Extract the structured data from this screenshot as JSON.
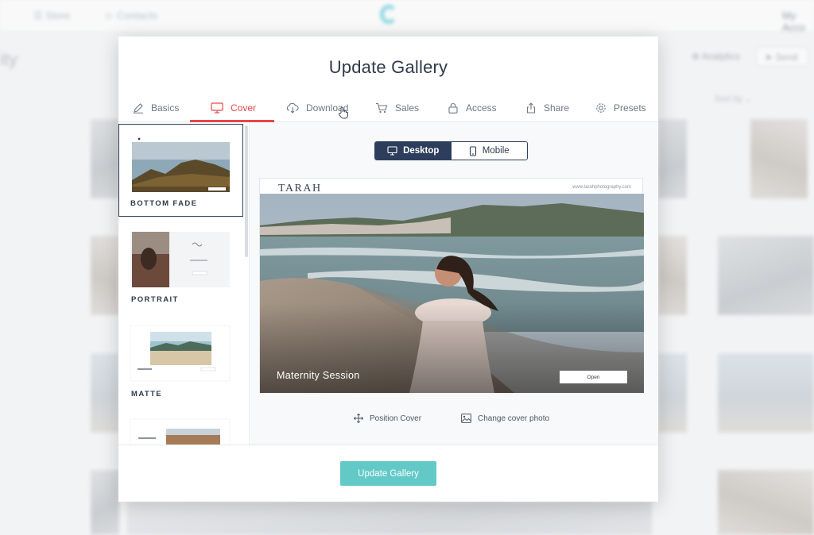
{
  "background": {
    "nav_store": "Store",
    "nav_contacts": "Contacts",
    "account": "My Acco",
    "page_title": "ity",
    "analytics": "Analytics",
    "send": "Send",
    "sort_by": "Sort by"
  },
  "modal": {
    "title": "Update Gallery",
    "tabs": [
      {
        "label": "Basics",
        "icon": "pencil-icon"
      },
      {
        "label": "Cover",
        "icon": "monitor-icon"
      },
      {
        "label": "Download",
        "icon": "cloud-download-icon"
      },
      {
        "label": "Sales",
        "icon": "cart-icon"
      },
      {
        "label": "Access",
        "icon": "lock-icon"
      },
      {
        "label": "Share",
        "icon": "share-icon"
      },
      {
        "label": "Presets",
        "icon": "gear-icon"
      }
    ],
    "active_tab": "Cover",
    "layouts": [
      {
        "label": "BOTTOM FADE",
        "selected": true
      },
      {
        "label": "PORTRAIT",
        "selected": false
      },
      {
        "label": "MATTE",
        "selected": false
      }
    ],
    "preview": {
      "toggle_desktop": "Desktop",
      "toggle_mobile": "Mobile",
      "brand": "TARAH",
      "site_url": "www.tarahphotography.com",
      "cover_title": "Maternity Session",
      "open_label": "Open",
      "position_cover": "Position Cover",
      "change_cover": "Change cover photo"
    },
    "update_button": "Update Gallery"
  },
  "colors": {
    "accent_red": "#e8474c",
    "navy": "#2c3e5c",
    "teal_button": "#62c9c7"
  }
}
